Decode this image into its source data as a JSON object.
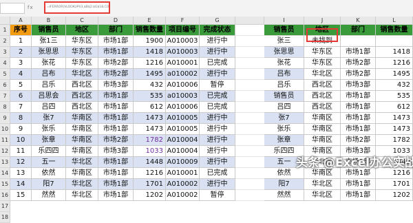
{
  "formula_bar": {
    "fx_label": "fx",
    "formula": "=IFERROR(VLOOKUP(I3,$B$2:$G$18,COLUMN(B1),0),\"未找到\")"
  },
  "columns": [
    "A",
    "B",
    "C",
    "D",
    "E",
    "F",
    "G",
    "",
    "I",
    "J",
    "K",
    "L"
  ],
  "rows": [
    "1",
    "2",
    "3",
    "4",
    "5",
    "6",
    "7",
    "8",
    "9",
    "10",
    "11",
    "12",
    "13",
    "14",
    "15",
    "16",
    "17",
    "18"
  ],
  "left_table": {
    "headers": [
      "序号",
      "销售员",
      "地区",
      "部门",
      "销售数量",
      "项目编号",
      "完成状态"
    ],
    "rows": [
      [
        "1",
        "张1三",
        "华东区",
        "市场1部",
        "1900",
        "A010003",
        "进行中"
      ],
      [
        "2",
        "张思思",
        "华东区",
        "市场1部",
        "1418",
        "A010003",
        "进行中"
      ],
      [
        "3",
        "张花",
        "华东区",
        "市场2部",
        "1216",
        "A010001",
        "已完成"
      ],
      [
        "4",
        "吕布",
        "华北区",
        "市场2部",
        "1495",
        "a010002",
        "进行中"
      ],
      [
        "5",
        "吕乐",
        "西北区",
        "市场3部",
        "432",
        "A010006",
        "暂停"
      ],
      [
        "6",
        "吕思会",
        "西北区",
        "市场1部",
        "535",
        "a010003",
        "已完成"
      ],
      [
        "7",
        "吕四",
        "西北区",
        "市场1部",
        "612",
        "A010006",
        "已完成"
      ],
      [
        "8",
        "张7",
        "华南区",
        "市场1部",
        "1473",
        "A010005",
        "进行中"
      ],
      [
        "9",
        "张乐",
        "华南区",
        "市场1部",
        "1473",
        "A010005",
        "进行中"
      ],
      [
        "10",
        "张章",
        "华南区",
        "市场2部",
        "1782",
        "A010004",
        "进行中"
      ],
      [
        "11",
        "乐四四",
        "华南区",
        "市场3部",
        "1033",
        "A010004",
        "进行中"
      ],
      [
        "12",
        "五一",
        "华北区",
        "市场1部",
        "1448",
        "A010009",
        "进行中"
      ],
      [
        "13",
        "依然",
        "华南区",
        "市场1部",
        "1216",
        "A010001",
        "已完成"
      ],
      [
        "14",
        "阳7",
        "华北区",
        "市场1部",
        "1701",
        "A010002",
        "进行中"
      ],
      [
        "15",
        "然然",
        "华北区",
        "市场1部",
        "1202",
        "A010002",
        "暂停"
      ]
    ]
  },
  "right_table": {
    "headers": [
      "销售员",
      "地区",
      "部门",
      "销售数量"
    ],
    "rows": [
      [
        "张三",
        "未找到",
        "",
        ""
      ],
      [
        "张思思",
        "华东区",
        "市场1部",
        "1418"
      ],
      [
        "张花",
        "华东区",
        "市场2部",
        "1216"
      ],
      [
        "吕布",
        "华北区",
        "市场2部",
        "1495"
      ],
      [
        "吕乐",
        "西北区",
        "市场3部",
        "432"
      ],
      [
        "销售员",
        "西北区",
        "市场1部",
        "535"
      ],
      [
        "吕四",
        "西北区",
        "市场1部",
        "612"
      ],
      [
        "张7",
        "华南区",
        "市场1部",
        "1473"
      ],
      [
        "张乐",
        "华南区",
        "市场1部",
        "1473"
      ],
      [
        "张章",
        "华南区",
        "市场2部",
        "1782"
      ],
      [
        "乐四四",
        "华南区",
        "市场3部",
        "1033"
      ],
      [
        "五一",
        "华北区",
        "市场1部",
        "1448"
      ],
      [
        "依然",
        "华南区",
        "市场1部",
        "1216"
      ],
      [
        "阳7",
        "华北区",
        "市场1部",
        "1701"
      ],
      [
        "然然",
        "华北区",
        "市场1部",
        "1202"
      ]
    ]
  },
  "watermark": "头条 @Excel办公实战",
  "colors": {
    "header_green": "#3a9b3a",
    "header_orange": "#f39c12",
    "band_blue": "#d9e1f2",
    "highlight_red": "#e53935",
    "purple_text": "#7030a0"
  }
}
